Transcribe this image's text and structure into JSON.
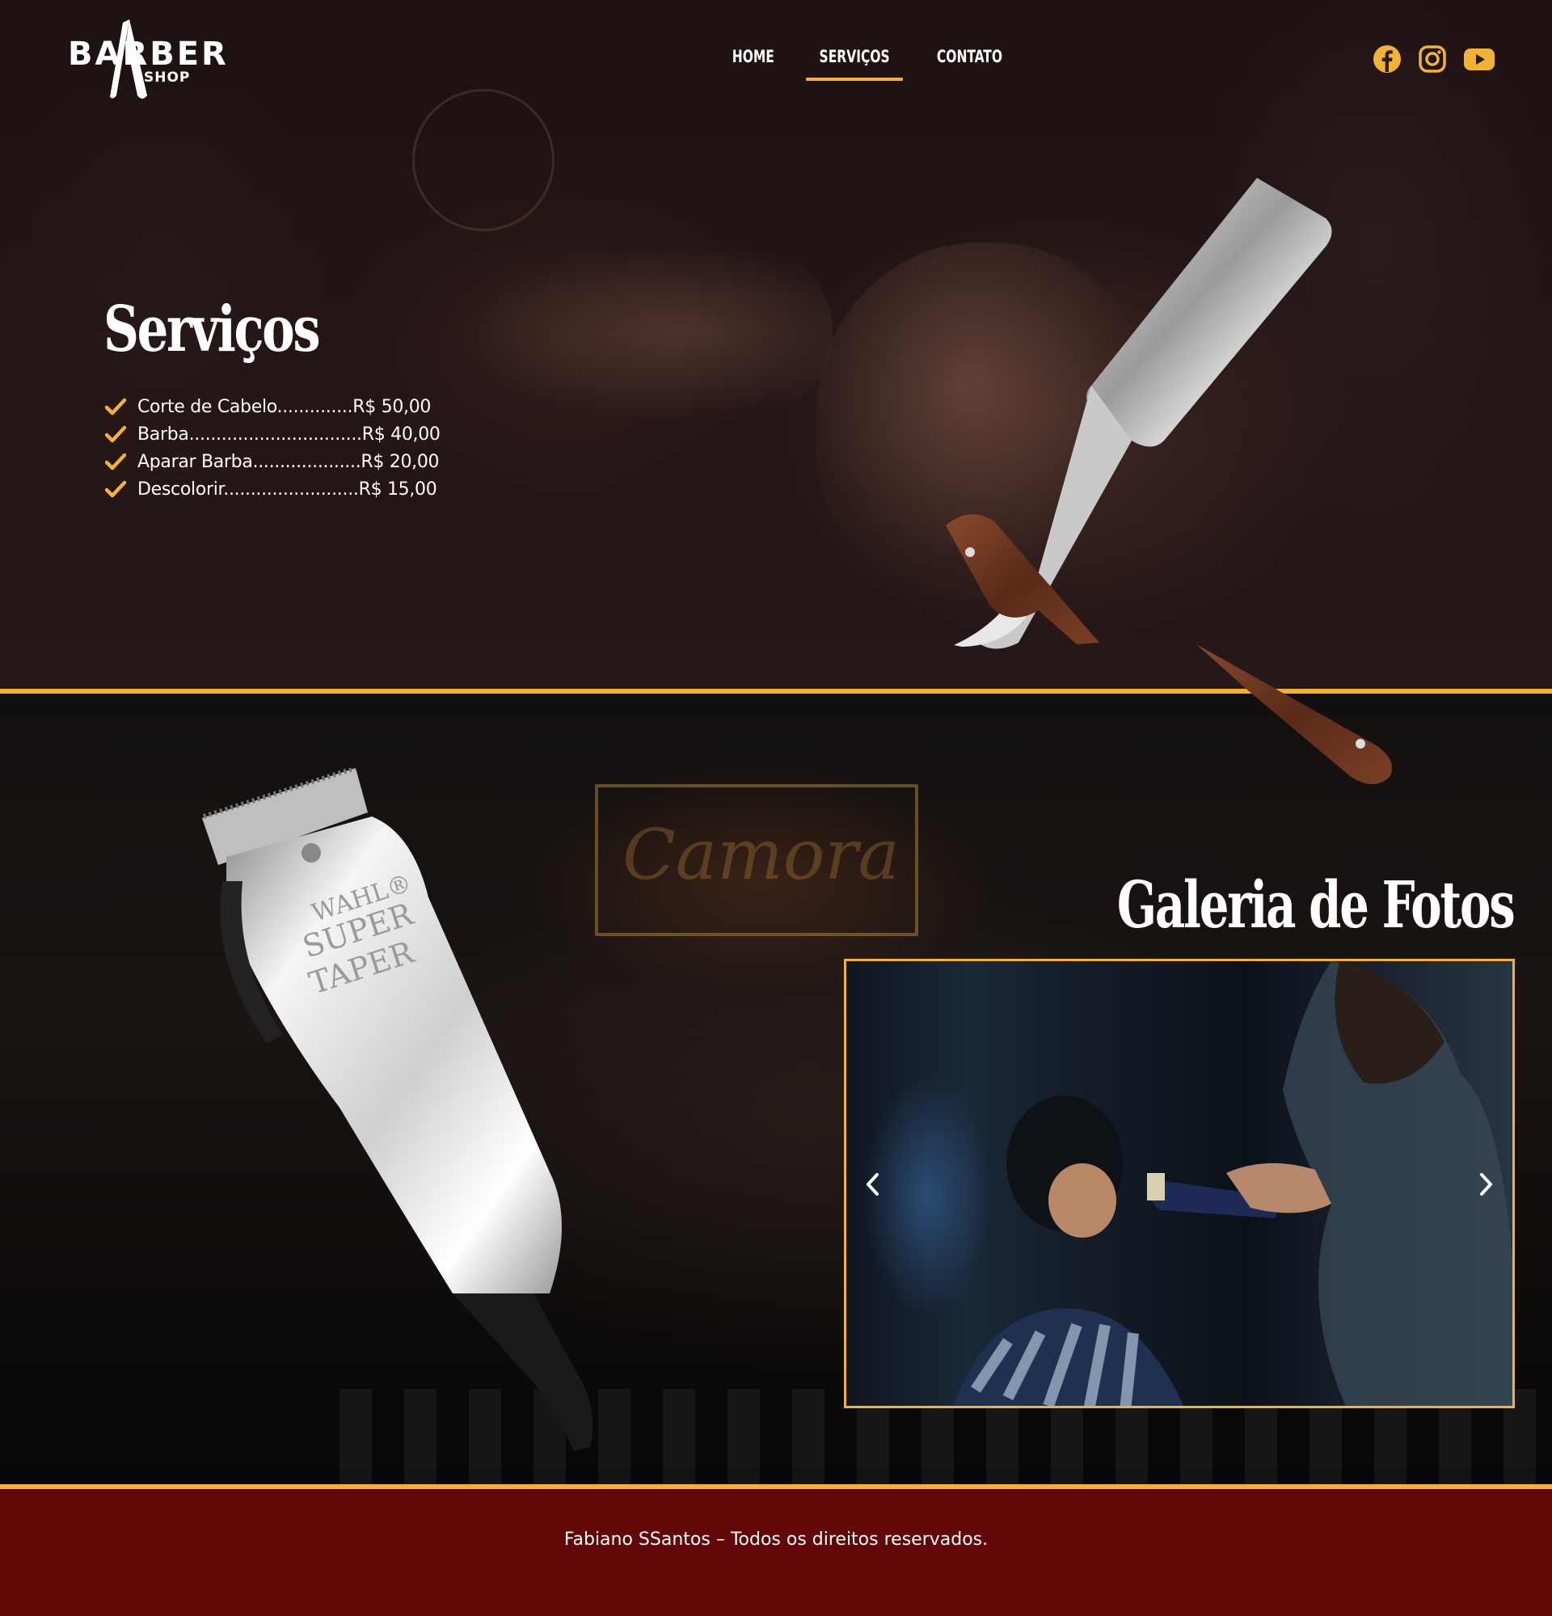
{
  "brand": {
    "logo_main": "BARBER",
    "logo_sub": "SHOP"
  },
  "nav": {
    "items": [
      "HOME",
      "SERVIÇOS",
      "CONTATO"
    ],
    "active": "SERVIÇOS"
  },
  "social": [
    "facebook-icon",
    "instagram-icon",
    "youtube-icon"
  ],
  "services": {
    "title": "Serviços",
    "items": [
      "Corte de Cabelo..............R$ 50,00",
      "Barba................................R$ 40,00",
      "Aparar Barba....................R$ 20,00",
      "Descolorir.........................R$ 15,00"
    ]
  },
  "gallery": {
    "title": "Galeria de Fotos",
    "background_sign": "Camora",
    "clipper_engraving": [
      "WAHL®",
      "SUPER",
      "TAPER"
    ]
  },
  "footer": {
    "text": "Fabiano SSantos – Todos os direitos reservados."
  },
  "colors": {
    "accent": "#f2b233",
    "footer_bg": "#630607",
    "text": "#ffffff"
  }
}
